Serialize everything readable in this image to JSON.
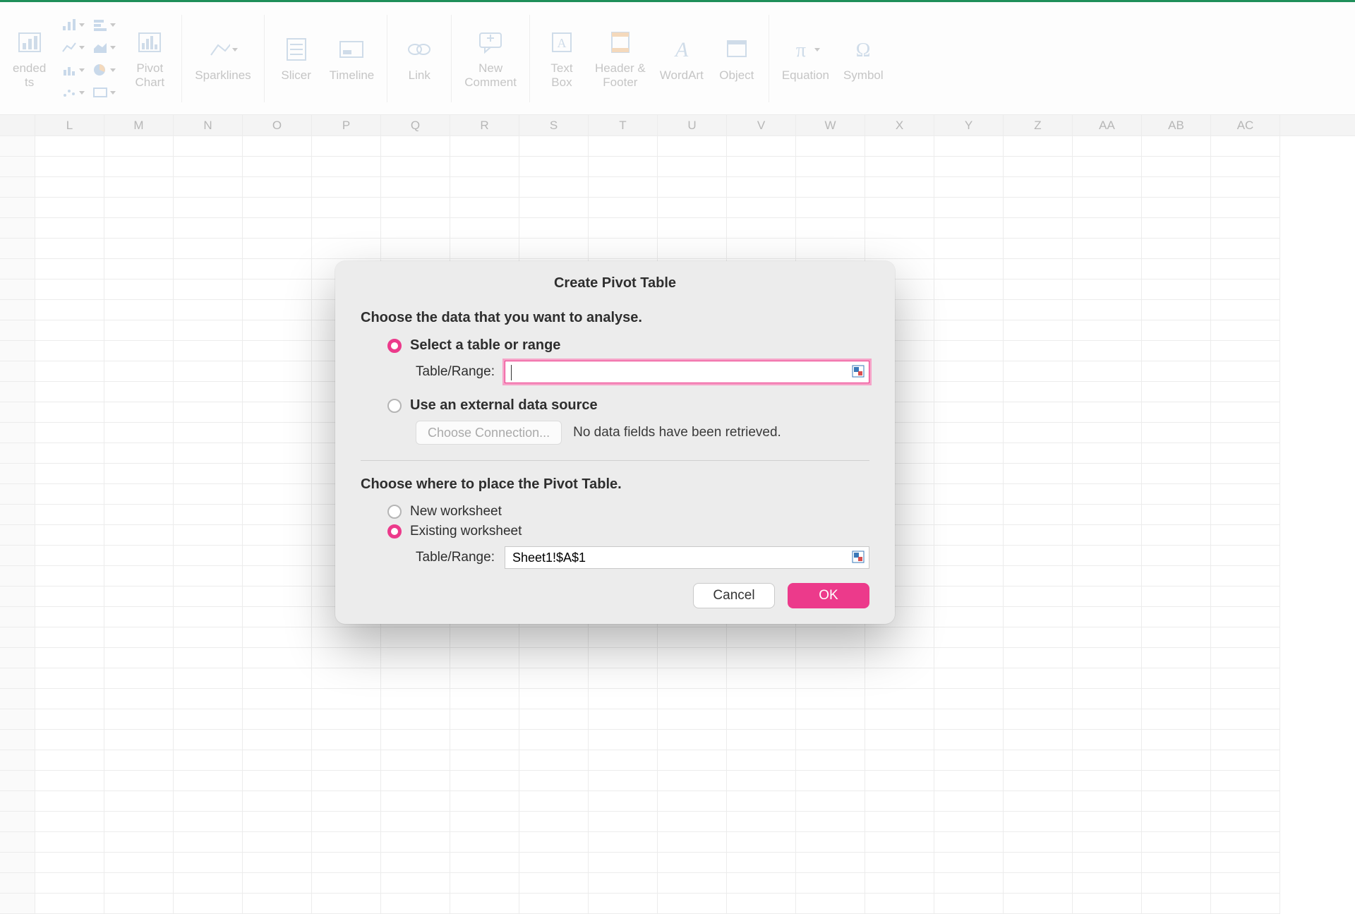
{
  "ribbon": {
    "recommended_charts": "ended\nts",
    "pivot_chart": "Pivot\nChart",
    "sparklines": "Sparklines",
    "slicer": "Slicer",
    "timeline": "Timeline",
    "link": "Link",
    "new_comment": "New\nComment",
    "text_box": "Text\nBox",
    "header_footer": "Header &\nFooter",
    "wordart": "WordArt",
    "object": "Object",
    "equation": "Equation",
    "symbol": "Symbol"
  },
  "columns": [
    "",
    "L",
    "M",
    "N",
    "O",
    "P",
    "Q",
    "R",
    "S",
    "T",
    "U",
    "V",
    "W",
    "X",
    "Y",
    "Z",
    "AA",
    "AB",
    "AC"
  ],
  "dialog": {
    "title": "Create Pivot Table",
    "section1_heading": "Choose the data that you want to analyse.",
    "opt_select_range": "Select a table or range",
    "table_range_label": "Table/Range:",
    "table_range_value": "",
    "opt_external": "Use an external data source",
    "choose_connection": "Choose Connection...",
    "no_data_fields": "No data fields have been retrieved.",
    "section2_heading": "Choose where to place the Pivot Table.",
    "opt_new_worksheet": "New worksheet",
    "opt_existing_worksheet": "Existing worksheet",
    "location_label": "Table/Range:",
    "location_value": "Sheet1!$A$1",
    "cancel": "Cancel",
    "ok": "OK"
  }
}
